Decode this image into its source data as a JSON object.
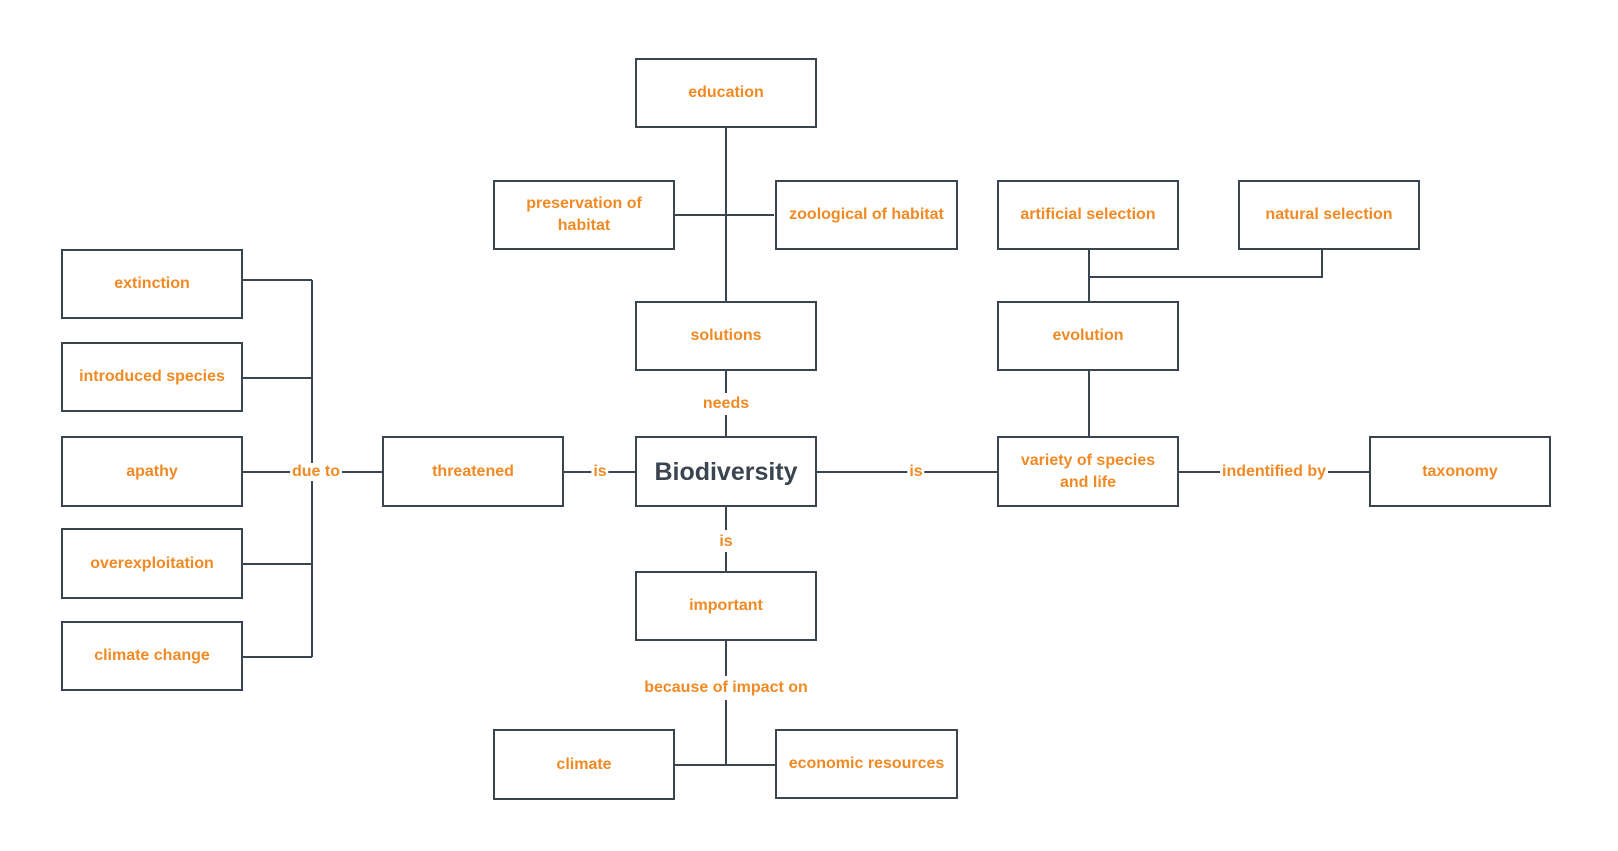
{
  "diagram": {
    "colors": {
      "node_text": "#f18a24",
      "main_text": "#3b4550",
      "border": "#3b4550",
      "line": "#3b4550"
    },
    "nodes": {
      "biodiversity": "Biodiversity",
      "education": "education",
      "preservation": "preservation of habitat",
      "zoological": "zoological of habitat",
      "solutions": "solutions",
      "threatened": "threatened",
      "extinction": "extinction",
      "introduced": "introduced species",
      "apathy": "apathy",
      "overexploitation": "overexploitation",
      "climate_change": "climate change",
      "important": "important",
      "climate": "climate",
      "economic": "economic resources",
      "variety": "variety of species and life",
      "evolution": "evolution",
      "artificial": "artificial selection",
      "natural": "natural selection",
      "taxonomy": "taxonomy"
    },
    "edge_labels": {
      "needs": "needs",
      "is_threatened": "is",
      "is_variety": "is",
      "is_important": "is",
      "due_to": "due to",
      "because": "because of impact on",
      "identified_by": "indentified by"
    }
  }
}
